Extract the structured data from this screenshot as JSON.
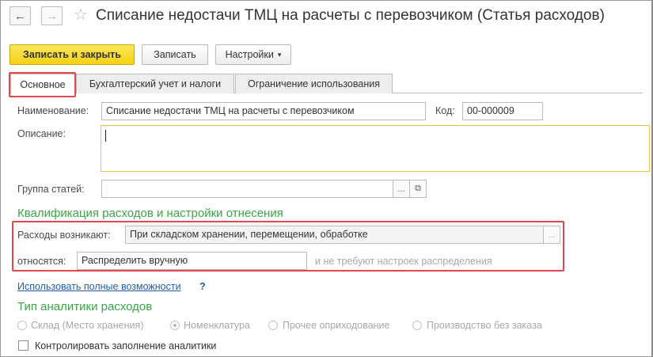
{
  "window": {
    "title": "Списание недостачи ТМЦ на расчеты с перевозчиком (Статья расходов)",
    "back_icon": "←",
    "forward_icon": "→",
    "star_icon": "☆"
  },
  "toolbar": {
    "save_close": "Записать и закрыть",
    "save": "Записать",
    "settings": "Настройки",
    "settings_caret": "▾"
  },
  "tabs": [
    {
      "label": "Основное"
    },
    {
      "label": "Бухгалтерский учет и налоги"
    },
    {
      "label": "Ограничение использования"
    }
  ],
  "form": {
    "name_label": "Наименование:",
    "name_value": "Списание недостачи ТМЦ на расчеты с перевозчиком",
    "code_label": "Код:",
    "code_value": "00-000009",
    "description_label": "Описание:",
    "description_value": "",
    "group_label": "Группа статей:",
    "group_value": "",
    "select_btn": "...",
    "open_btn": "⧉"
  },
  "qualification": {
    "header": "Квалификация расходов и настройки отнесения",
    "arise_label": "Расходы возникают:",
    "arise_value": "При складском хранении, перемещении, обработке",
    "arise_btn": "...",
    "relate_label": "относятся:",
    "relate_value": "Распределить вручную",
    "relate_hint": "и не требуют настроек распределения"
  },
  "full_features": {
    "link": "Использовать полные возможности",
    "help": "?"
  },
  "analytics": {
    "header": "Тип аналитики расходов",
    "options": [
      {
        "label": "Склад (Место хранения)",
        "selected": false
      },
      {
        "label": "Номенклатура",
        "selected": true
      },
      {
        "label": "Прочее оприходование",
        "selected": false
      },
      {
        "label": "Производство без заказа",
        "selected": false
      }
    ],
    "control_label": "Контролировать заполнение аналитики",
    "control_checked": false
  },
  "colors": {
    "accent_green": "#3aa646",
    "highlight_red": "#e0494f",
    "primary_yellow": "#f5d215",
    "link_blue": "#2160a8"
  }
}
